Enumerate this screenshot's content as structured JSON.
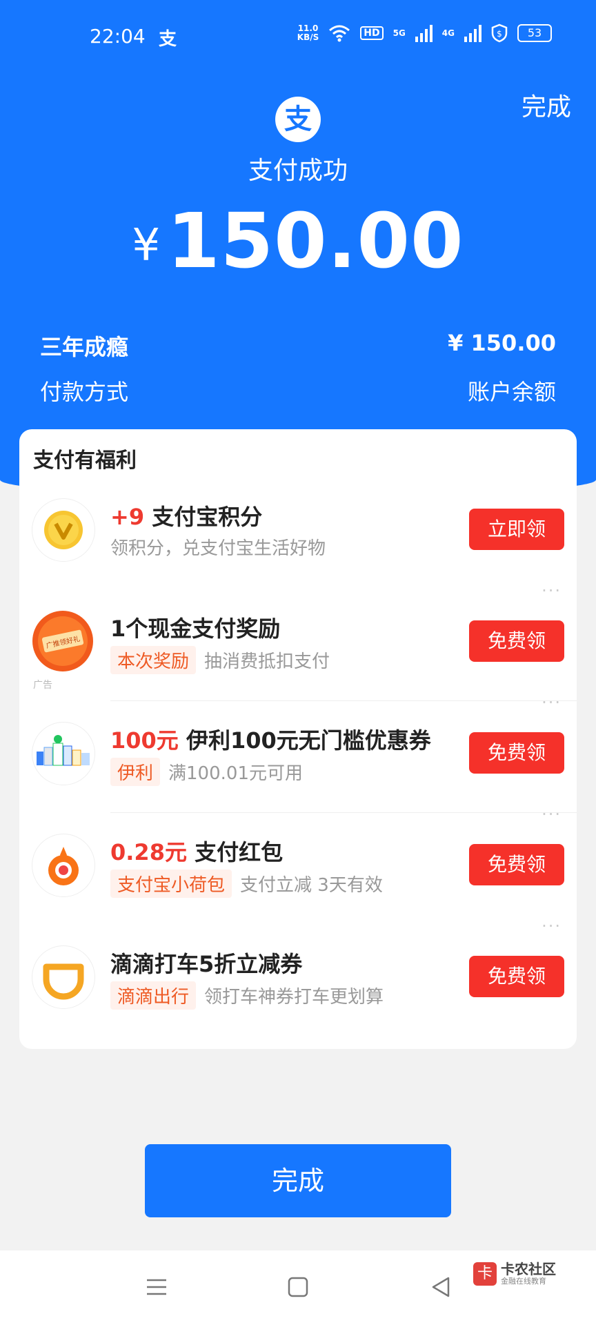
{
  "status_bar": {
    "time": "22:04",
    "app_glyph": "支",
    "speed_value": "11.0",
    "speed_unit": "KB/S",
    "hd_label": "HD",
    "net1": "5G",
    "net2": "4G",
    "battery": "53"
  },
  "header": {
    "done_label": "完成",
    "logo_glyph": "支",
    "title": "支付成功",
    "currency": "¥",
    "amount": "150.00"
  },
  "details": {
    "merchant": "三年成瘾",
    "merchant_amount": "¥ 150.00",
    "method_label": "付款方式",
    "method_value": "账户余额"
  },
  "benefits": {
    "title": "支付有福利",
    "items": [
      {
        "highlight": "+9",
        "title": "支付宝积分",
        "badge": "",
        "desc": "领积分，兑支付宝生活好物",
        "button": "立即领"
      },
      {
        "highlight": "",
        "title": "1个现金支付奖励",
        "badge": "本次奖励",
        "desc": "抽消费抵扣支付",
        "button": "免费领",
        "ad": "广告",
        "icon_text": "广推领好礼"
      },
      {
        "highlight": "100元",
        "title": "伊利100元无门槛优惠券",
        "badge": "伊利",
        "desc": "满100.01元可用",
        "button": "免费领"
      },
      {
        "highlight": "0.28元",
        "title": "支付红包",
        "badge": "支付宝小荷包",
        "desc": "支付立减 3天有效",
        "button": "免费领"
      },
      {
        "highlight": "",
        "title": "滴滴打车5折立减券",
        "badge": "滴滴出行",
        "desc": "领打车神券打车更划算",
        "button": "免费领"
      }
    ]
  },
  "footer": {
    "done_label": "完成"
  },
  "watermark": {
    "mark": "卡",
    "title": "卡农社区",
    "subtitle": "金融在线教育"
  },
  "colors": {
    "brand": "#1677ff",
    "button_red": "#f5312a",
    "highlight_red": "#ee3a30"
  }
}
